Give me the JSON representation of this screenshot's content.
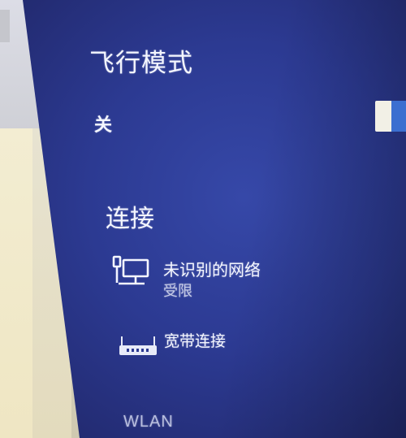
{
  "airplane_mode": {
    "title": "飞行模式",
    "state_label": "关"
  },
  "connections": {
    "title": "连接",
    "items": [
      {
        "name": "未识别的网络",
        "status": "受限",
        "icon": "ethernet-icon"
      },
      {
        "name": "宽带连接",
        "icon": "dialup-modem-icon"
      }
    ]
  },
  "wlan": {
    "title": "WLAN"
  },
  "colors": {
    "pane_background": "#2c3a92",
    "text": "#f4f6ff",
    "toggle_on": "#3b6fd0"
  }
}
